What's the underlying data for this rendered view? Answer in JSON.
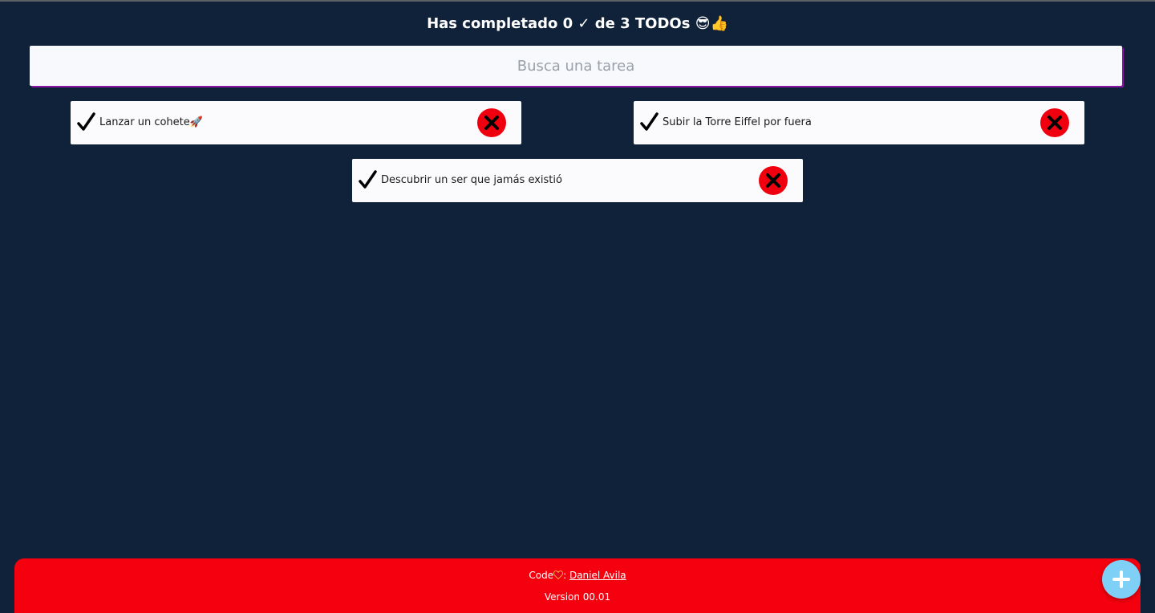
{
  "header": {
    "title": "Has completado 0 ✓ de 3 TODOs 😎👍"
  },
  "search": {
    "placeholder": "Busca una tarea",
    "value": ""
  },
  "todos": [
    {
      "text": "Lanzar un cohete🚀",
      "completed": false
    },
    {
      "text": "Subir la Torre Eiffel por fuera",
      "completed": false
    },
    {
      "text": "Descubrir un ser que jamás existió",
      "completed": false
    }
  ],
  "footer": {
    "credit_prefix": "Code",
    "credit_separator": ":",
    "author_link": "Daniel Avila",
    "version": "Version 00.01"
  },
  "icons": {
    "check": "check-icon",
    "delete": "close-icon",
    "add": "plus-icon",
    "heart": "heart-icon"
  },
  "colors": {
    "background": "#10223a",
    "delete_button": "#f0000e",
    "footer": "#f5000e",
    "add_button": "#7fd0f7",
    "search_shadow": "#8a16a8"
  }
}
